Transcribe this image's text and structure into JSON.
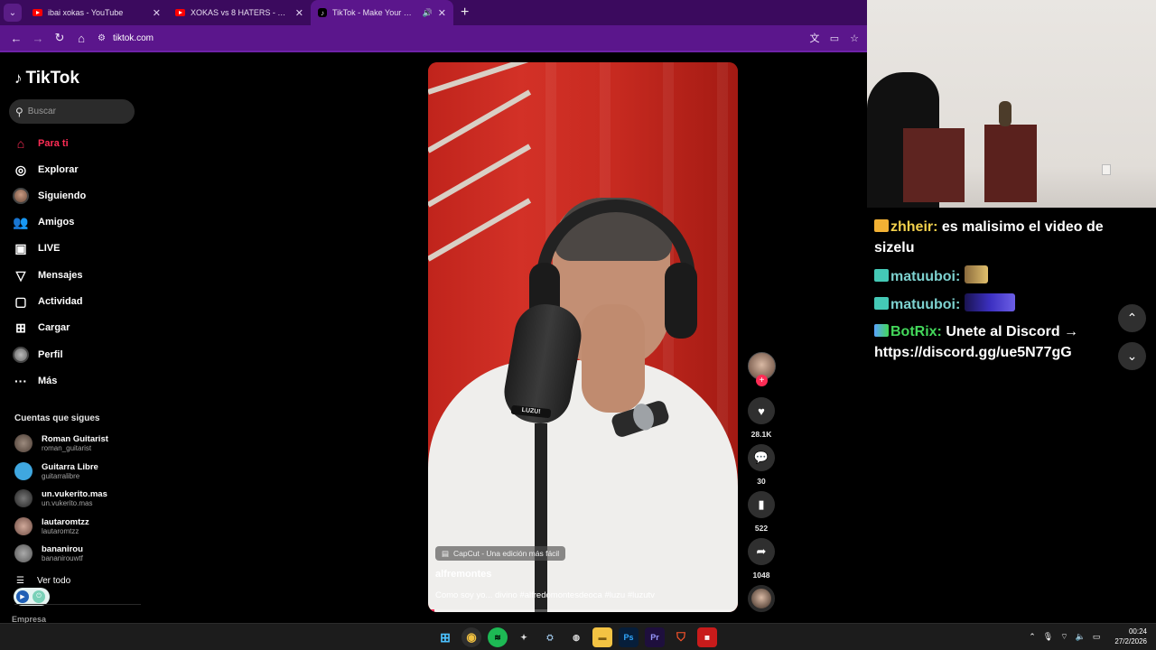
{
  "browser": {
    "tabs": [
      {
        "label": "ibai xokas - YouTube",
        "icon": "youtube-icon",
        "active": false
      },
      {
        "label": "XOKAS vs 8 HATERS - YouTube",
        "icon": "youtube-icon",
        "active": false
      },
      {
        "label": "TikTok - Make Your Day",
        "icon": "tiktok-icon",
        "active": true
      }
    ],
    "url": "tiktok.com"
  },
  "tiktok": {
    "logo": "TikTok",
    "search_placeholder": "Buscar",
    "nav": [
      {
        "label": "Para ti",
        "icon": "home-icon"
      },
      {
        "label": "Explorar",
        "icon": "compass-icon"
      },
      {
        "label": "Siguiendo",
        "icon": "avatar"
      },
      {
        "label": "Amigos",
        "icon": "friends-icon"
      },
      {
        "label": "LIVE",
        "icon": "live-icon"
      },
      {
        "label": "Mensajes",
        "icon": "send-icon"
      },
      {
        "label": "Actividad",
        "icon": "activity-icon"
      },
      {
        "label": "Cargar",
        "icon": "upload-icon"
      },
      {
        "label": "Perfil",
        "icon": "avatar"
      },
      {
        "label": "Más",
        "icon": "more-icon"
      }
    ],
    "following_title": "Cuentas que sigues",
    "following": [
      {
        "name": "Roman Guitarist",
        "handle": "roman_guitarist"
      },
      {
        "name": "Guitarra Libre",
        "handle": "guitarralibre"
      },
      {
        "name": "un.vukerito.mas",
        "handle": "un.vukerito.mas"
      },
      {
        "name": "lautaromtzz",
        "handle": "lautaromtzz"
      },
      {
        "name": "bananirou",
        "handle": "bananirouwtf"
      }
    ],
    "see_all": "Ver todo",
    "empresa": "Empresa",
    "video": {
      "mic_label": "LUZU!",
      "capcut": "CapCut - Una edición más fácil",
      "author": "alfremontes",
      "caption": "Como soy yo... divino #alfredomontesdeoca #luzu #luzutv",
      "progress": 0.02
    },
    "actions": {
      "likes": "28.1K",
      "comments": "30",
      "saves": "522",
      "shares": "1048"
    },
    "accent": "#fe2c55"
  },
  "chat": [
    {
      "user": "zhheir:",
      "text": "es malisimo el video de sizelu",
      "badge": "crown-icon"
    },
    {
      "user": "matuuboi:",
      "text": "",
      "badge": "subscriber-badge"
    },
    {
      "user": "matuuboi:",
      "text": "",
      "badge": "subscriber-badge"
    },
    {
      "user": "BotRix:",
      "text": "Unete al Discord → https://discord.gg/ue5N77gG",
      "badge": "bot-badge"
    }
  ],
  "taskbar": {
    "time": "00:24",
    "date": "27/2/2026"
  }
}
